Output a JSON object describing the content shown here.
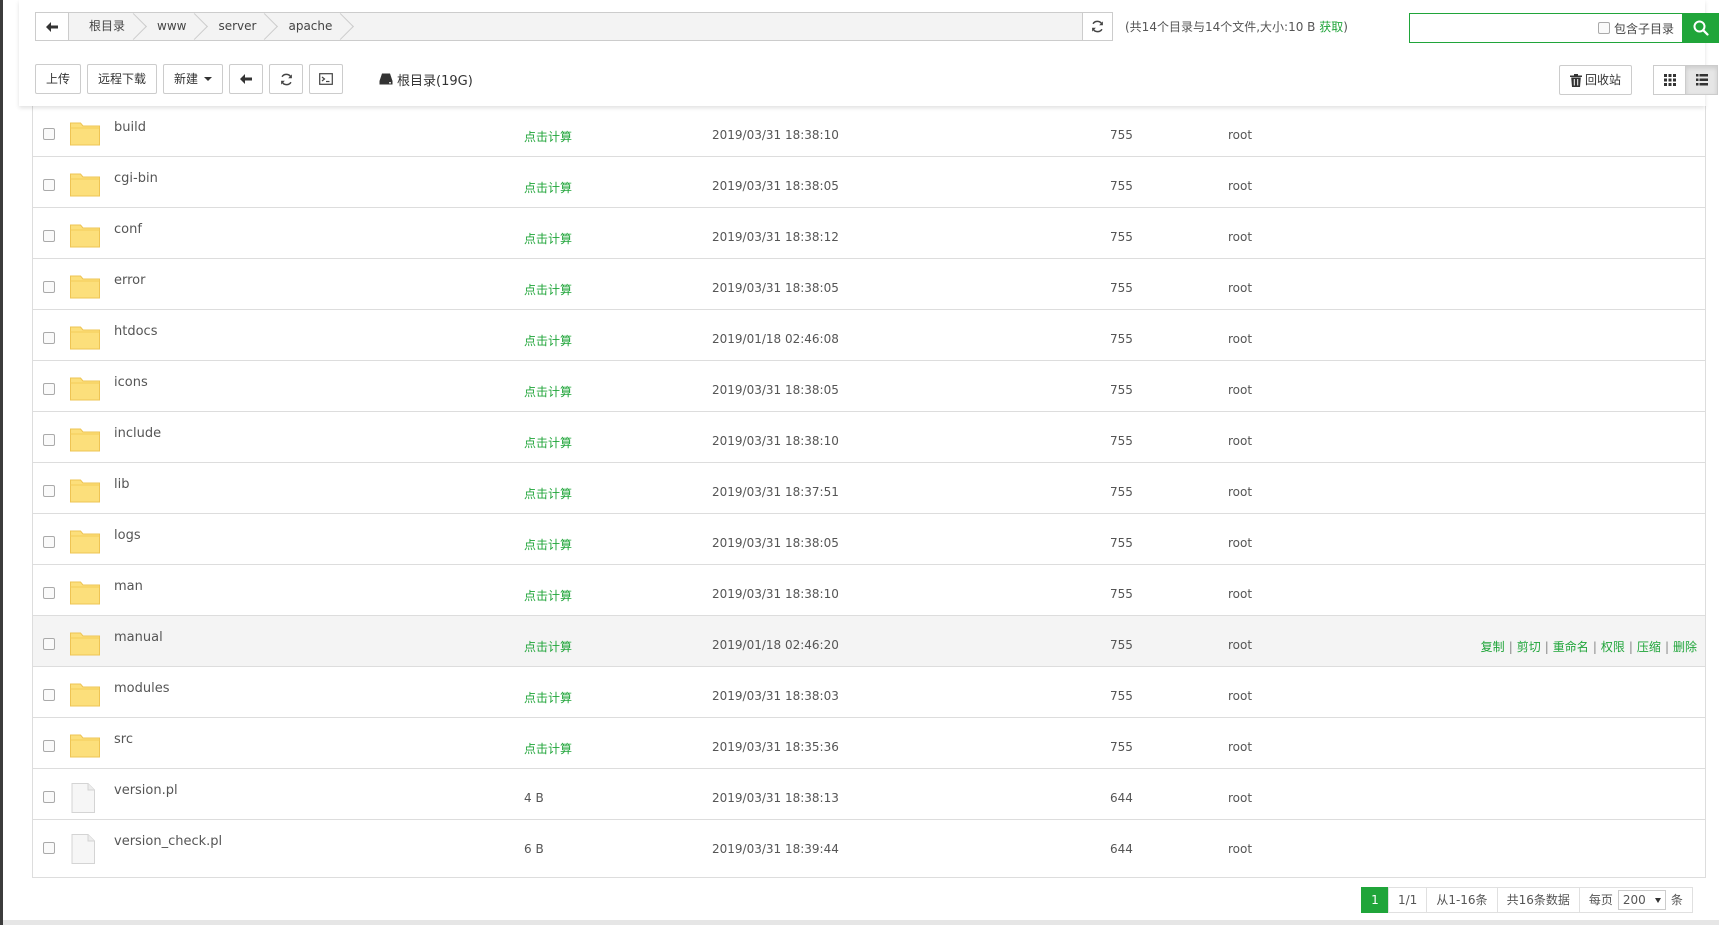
{
  "path": {
    "crumbs": [
      "根目录",
      "www",
      "server",
      "apache"
    ],
    "info": "(共14个目录与14个文件,大小:10 B",
    "fetch_label": "获取",
    "info_close": ")"
  },
  "search": {
    "placeholder": "",
    "subdir_label": "包含子目录"
  },
  "toolbar": {
    "upload": "上传",
    "remote_download": "远程下载",
    "new": "新建",
    "disk_label": "根目录(19G)",
    "recycle": "回收站"
  },
  "colors": {
    "accent": "#20a53a",
    "folder": "#fcdf7b"
  },
  "files": [
    {
      "name": "build",
      "type": "folder",
      "size": "点击计算",
      "mtime": "2019/03/31 18:38:10",
      "perm": "755",
      "owner": "root"
    },
    {
      "name": "cgi-bin",
      "type": "folder",
      "size": "点击计算",
      "mtime": "2019/03/31 18:38:05",
      "perm": "755",
      "owner": "root"
    },
    {
      "name": "conf",
      "type": "folder",
      "size": "点击计算",
      "mtime": "2019/03/31 18:38:12",
      "perm": "755",
      "owner": "root"
    },
    {
      "name": "error",
      "type": "folder",
      "size": "点击计算",
      "mtime": "2019/03/31 18:38:05",
      "perm": "755",
      "owner": "root"
    },
    {
      "name": "htdocs",
      "type": "folder",
      "size": "点击计算",
      "mtime": "2019/01/18 02:46:08",
      "perm": "755",
      "owner": "root"
    },
    {
      "name": "icons",
      "type": "folder",
      "size": "点击计算",
      "mtime": "2019/03/31 18:38:05",
      "perm": "755",
      "owner": "root"
    },
    {
      "name": "include",
      "type": "folder",
      "size": "点击计算",
      "mtime": "2019/03/31 18:38:10",
      "perm": "755",
      "owner": "root"
    },
    {
      "name": "lib",
      "type": "folder",
      "size": "点击计算",
      "mtime": "2019/03/31 18:37:51",
      "perm": "755",
      "owner": "root"
    },
    {
      "name": "logs",
      "type": "folder",
      "size": "点击计算",
      "mtime": "2019/03/31 18:38:05",
      "perm": "755",
      "owner": "root"
    },
    {
      "name": "man",
      "type": "folder",
      "size": "点击计算",
      "mtime": "2019/03/31 18:38:10",
      "perm": "755",
      "owner": "root"
    },
    {
      "name": "manual",
      "type": "folder",
      "size": "点击计算",
      "mtime": "2019/01/18 02:46:20",
      "perm": "755",
      "owner": "root"
    },
    {
      "name": "modules",
      "type": "folder",
      "size": "点击计算",
      "mtime": "2019/03/31 18:38:03",
      "perm": "755",
      "owner": "root"
    },
    {
      "name": "src",
      "type": "folder",
      "size": "点击计算",
      "mtime": "2019/03/31 18:35:36",
      "perm": "755",
      "owner": "root"
    },
    {
      "name": "version.pl",
      "type": "file",
      "size": "4 B",
      "mtime": "2019/03/31 18:38:13",
      "perm": "644",
      "owner": "root"
    },
    {
      "name": "version_check.pl",
      "type": "file",
      "size": "6 B",
      "mtime": "2019/03/31 18:39:44",
      "perm": "644",
      "owner": "root"
    }
  ],
  "hover_row_index": 10,
  "row_actions": [
    "复制",
    "剪切",
    "重命名",
    "权限",
    "压缩",
    "删除"
  ],
  "pager": {
    "current": "1",
    "pages": "1/1",
    "range": "从1-16条",
    "total": "共16条数据",
    "per_page_label": "每页",
    "per_page": "200",
    "unit": "条"
  }
}
